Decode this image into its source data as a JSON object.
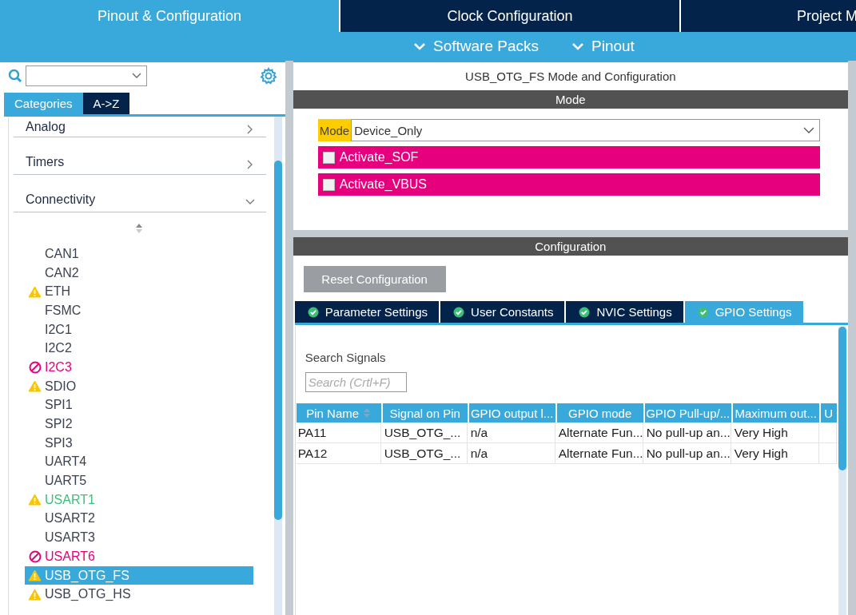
{
  "main_tabs": [
    {
      "label": "Pinout & Configuration",
      "selected": true
    },
    {
      "label": "Clock Configuration",
      "selected": false
    },
    {
      "label": "Project M",
      "selected": false
    }
  ],
  "sub_menus": [
    {
      "label": "Software Packs"
    },
    {
      "label": "Pinout"
    }
  ],
  "sidebar": {
    "view_tabs": [
      {
        "label": "Categories",
        "selected": true
      },
      {
        "label": "A->Z",
        "selected": false
      }
    ],
    "categories": [
      {
        "label": "Analog",
        "expanded": false
      },
      {
        "label": "Timers",
        "expanded": false
      },
      {
        "label": "Connectivity",
        "expanded": true
      }
    ],
    "items": [
      {
        "label": "CAN1",
        "warning": false,
        "blocked": false,
        "configured": false,
        "selected": false
      },
      {
        "label": "CAN2",
        "warning": false,
        "blocked": false,
        "configured": false,
        "selected": false
      },
      {
        "label": "ETH",
        "warning": true,
        "blocked": false,
        "configured": false,
        "selected": false
      },
      {
        "label": "FSMC",
        "warning": false,
        "blocked": false,
        "configured": false,
        "selected": false
      },
      {
        "label": "I2C1",
        "warning": false,
        "blocked": false,
        "configured": false,
        "selected": false
      },
      {
        "label": "I2C2",
        "warning": false,
        "blocked": false,
        "configured": false,
        "selected": false
      },
      {
        "label": "I2C3",
        "warning": false,
        "blocked": true,
        "configured": false,
        "selected": false
      },
      {
        "label": "SDIO",
        "warning": true,
        "blocked": false,
        "configured": false,
        "selected": false
      },
      {
        "label": "SPI1",
        "warning": false,
        "blocked": false,
        "configured": false,
        "selected": false
      },
      {
        "label": "SPI2",
        "warning": false,
        "blocked": false,
        "configured": false,
        "selected": false
      },
      {
        "label": "SPI3",
        "warning": false,
        "blocked": false,
        "configured": false,
        "selected": false
      },
      {
        "label": "UART4",
        "warning": false,
        "blocked": false,
        "configured": false,
        "selected": false
      },
      {
        "label": "UART5",
        "warning": false,
        "blocked": false,
        "configured": false,
        "selected": false
      },
      {
        "label": "USART1",
        "warning": true,
        "blocked": false,
        "configured": true,
        "selected": false
      },
      {
        "label": "USART2",
        "warning": false,
        "blocked": false,
        "configured": false,
        "selected": false
      },
      {
        "label": "USART3",
        "warning": false,
        "blocked": false,
        "configured": false,
        "selected": false
      },
      {
        "label": "USART6",
        "warning": false,
        "blocked": true,
        "configured": false,
        "selected": false
      },
      {
        "label": "USB_OTG_FS",
        "warning": true,
        "blocked": false,
        "configured": false,
        "selected": true
      },
      {
        "label": "USB_OTG_HS",
        "warning": true,
        "blocked": false,
        "configured": false,
        "selected": false
      }
    ]
  },
  "mode_panel": {
    "title": "USB_OTG_FS Mode and Configuration",
    "header": "Mode",
    "mode_label": "Mode",
    "mode_value": "Device_Only",
    "options": [
      {
        "label": "Activate_SOF",
        "checked": false
      },
      {
        "label": "Activate_VBUS",
        "checked": false
      }
    ]
  },
  "config_panel": {
    "header": "Configuration",
    "reset_button": "Reset Configuration",
    "tabs": [
      {
        "label": "Parameter Settings",
        "selected": false
      },
      {
        "label": "User Constants",
        "selected": false
      },
      {
        "label": "NVIC Settings",
        "selected": false
      },
      {
        "label": "GPIO Settings",
        "selected": true
      }
    ],
    "search_label": "Search Signals",
    "search_placeholder": "Search (Crtl+F)",
    "table": {
      "columns": [
        "Pin Name",
        "Signal on Pin",
        "GPIO output l...",
        "GPIO mode",
        "GPIO Pull-up/...",
        "Maximum out...",
        "U"
      ],
      "rows": [
        [
          "PA11",
          "USB_OTG_...",
          "n/a",
          "Alternate Fun...",
          "No pull-up an...",
          "Very High",
          ""
        ],
        [
          "PA12",
          "USB_OTG_...",
          "n/a",
          "Alternate Fun...",
          "No pull-up an...",
          "Very High",
          ""
        ]
      ]
    }
  }
}
